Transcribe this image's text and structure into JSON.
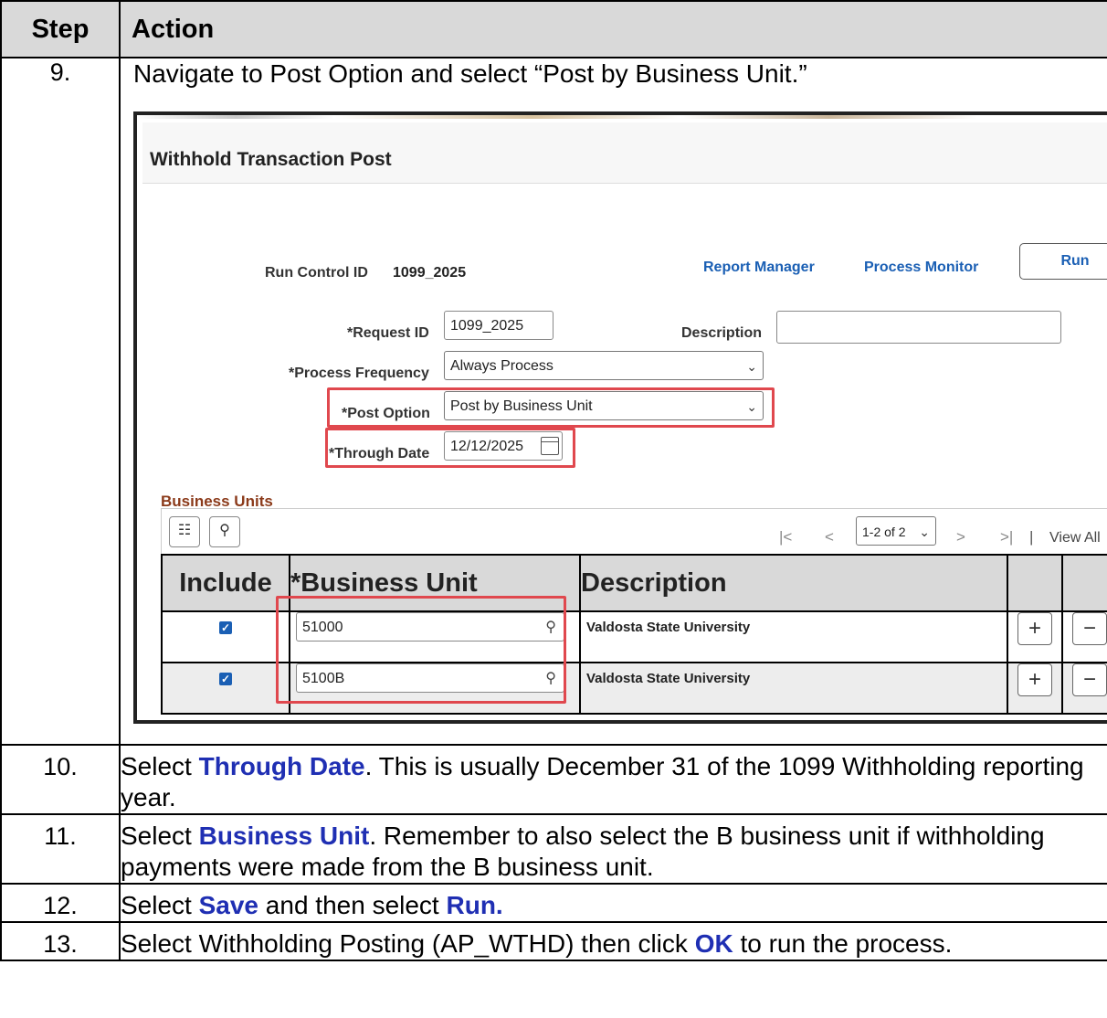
{
  "header": {
    "step": "Step",
    "action": "Action"
  },
  "rows": [
    {
      "num": "9.",
      "text": "Navigate to Post Option and select “Post by Business Unit.”"
    },
    {
      "num": "10.",
      "pre": "Select ",
      "kw": "Through Date",
      "post": ". This is usually December 31 of the 1099 Withholding reporting year."
    },
    {
      "num": "11.",
      "pre": "Select ",
      "kw": "Business Unit",
      "post": ". Remember to also select the B business unit if withholding payments were made from the B business unit."
    },
    {
      "num": "12.",
      "pre": "Select ",
      "kw": "Save",
      "mid": " and then select ",
      "kw2": "Run."
    },
    {
      "num": "13.",
      "pre": "Select Withholding Posting (AP_WTHD) then click ",
      "kw": "OK",
      "post": " to run the process."
    }
  ],
  "screenshot": {
    "title": "Withhold Transaction Post",
    "run_control_label": "Run Control ID",
    "run_control_value": "1099_2025",
    "report_manager": "Report Manager",
    "process_monitor": "Process Monitor",
    "run_button": "Run",
    "request_id_label": "*Request ID",
    "request_id_value": "1099_2025",
    "description_label": "Description",
    "description_value": "",
    "process_frequency_label": "*Process Frequency",
    "process_frequency_value": "Always Process",
    "post_option_label": "*Post Option",
    "post_option_value": "Post by Business Unit",
    "through_date_label": "*Through Date",
    "through_date_value": "12/12/2025",
    "business_units_title": "Business Units",
    "pagination": "1-2 of 2",
    "view_all": "View All",
    "col_include": "Include",
    "col_business_unit": "*Business Unit",
    "col_description": "Description",
    "bu_rows": [
      {
        "unit": "51000",
        "description": "Valdosta State University"
      },
      {
        "unit": "5100B",
        "description": "Valdosta State University"
      }
    ],
    "accent_color": "#1a5fb4",
    "highlight_color": "#e0484e"
  }
}
